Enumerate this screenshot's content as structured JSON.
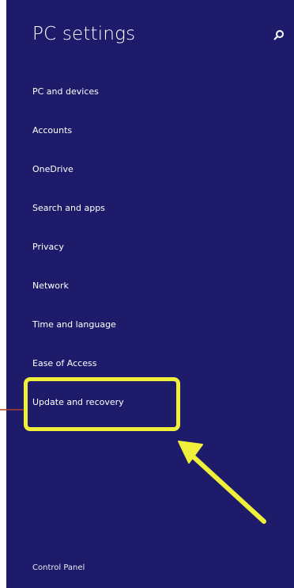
{
  "window": {
    "title": "PC settings",
    "search_icon": "search-icon"
  },
  "nav": {
    "items": [
      {
        "label": "PC and devices"
      },
      {
        "label": "Accounts"
      },
      {
        "label": "OneDrive"
      },
      {
        "label": "Search and apps"
      },
      {
        "label": "Privacy"
      },
      {
        "label": "Network"
      },
      {
        "label": "Time and language"
      },
      {
        "label": "Ease of Access"
      },
      {
        "label": "Update and recovery"
      }
    ],
    "highlighted_item": "Update and recovery"
  },
  "footer": {
    "control_panel_label": "Control Panel"
  },
  "colors": {
    "panel_background": "#1e1c6a",
    "text": "#ffffff",
    "highlight": "#f0f03a",
    "pointer_line": "#b0412a"
  }
}
